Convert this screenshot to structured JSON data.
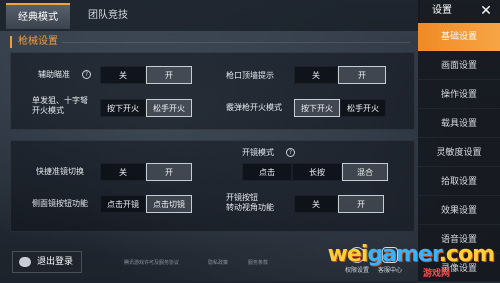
{
  "tabs": [
    {
      "label": "经典模式",
      "active": true
    },
    {
      "label": "团队竞技",
      "active": false
    }
  ],
  "section_title": "枪械设置",
  "settings": {
    "aim_assist": {
      "label": "辅助瞄准",
      "options": [
        "关",
        "开"
      ],
      "selected": 1
    },
    "muzzle_hint": {
      "label": "枪口顶墙提示",
      "options": [
        "关",
        "开"
      ],
      "selected": 1
    },
    "single_fire": {
      "label": "单发狙、十字弩\n开火模式",
      "options": [
        "按下开火",
        "松手开火"
      ],
      "selected": 1
    },
    "shotgun_fire": {
      "label": "霰弹枪开火模式",
      "options": [
        "按下开火",
        "松手开火"
      ],
      "selected": 0
    },
    "quick_scope": {
      "label": "快捷准镜切换",
      "options": [
        "关",
        "开"
      ],
      "selected": 1
    },
    "scope_mode": {
      "label": "开镜模式",
      "options": [
        "点击",
        "长按",
        "混合"
      ],
      "selected": 2
    },
    "side_scope": {
      "label": "侧面镜按钮功能",
      "options": [
        "点击开镜",
        "点击切镜"
      ],
      "selected": 1
    },
    "scope_view": {
      "label": "开镜按钮\n转动视角功能",
      "options": [
        "关",
        "开"
      ],
      "selected": 1
    }
  },
  "sidebar": {
    "title": "设置",
    "close_icon": "close-icon",
    "items": [
      {
        "label": "基础设置",
        "active": true
      },
      {
        "label": "画面设置",
        "active": false
      },
      {
        "label": "操作设置",
        "active": false
      },
      {
        "label": "载具设置",
        "active": false
      },
      {
        "label": "灵敏度设置",
        "active": false
      },
      {
        "label": "拾取设置",
        "active": false
      },
      {
        "label": "效果设置",
        "active": false
      },
      {
        "label": "语音设置",
        "active": false
      },
      {
        "label": "录像设置",
        "active": false
      }
    ]
  },
  "bottom": {
    "logout_label": "退出登录",
    "links": [
      "腾讯游戏许可及服务协议",
      "隐私政策",
      "服务条款"
    ],
    "permission_label": "权限设置",
    "customer_label": "客服中心"
  },
  "watermark": {
    "text_a": "wei",
    "text_b": "gamer",
    "text_c": ".com",
    "sub": "游戏网"
  },
  "colors": {
    "accent": "#f08a24",
    "section": "#f39b3a"
  }
}
